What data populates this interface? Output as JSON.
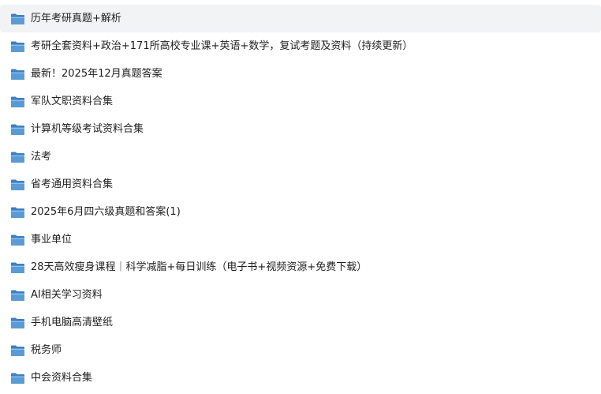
{
  "colors": {
    "folder_body": "#5b9bd5",
    "folder_tab": "#3f7fc1",
    "folder_front": "#8cc0ee",
    "selected_row_bg": "#f2f3f5",
    "text": "#1f1f1f"
  },
  "icons": {
    "folder": "folder-icon"
  },
  "items": [
    {
      "name": "历年考研真题+解析",
      "selected": true
    },
    {
      "name": "考研全套资料+政治+171所高校专业课+英语+数学，复试考题及资料（持续更新）",
      "selected": false
    },
    {
      "name": "最新！2025年12月真题答案",
      "selected": false
    },
    {
      "name": "军队文职资料合集",
      "selected": false
    },
    {
      "name": "计算机等级考试资料合集",
      "selected": false
    },
    {
      "name": "法考",
      "selected": false
    },
    {
      "name": "省考通用资料合集",
      "selected": false
    },
    {
      "name": "2025年6月四六级真题和答案(1)",
      "selected": false
    },
    {
      "name": "事业单位",
      "selected": false
    },
    {
      "name": "28天高效瘦身课程｜科学减脂+每日训练（电子书+视频资源+免费下载）",
      "selected": false
    },
    {
      "name": "AI相关学习资料",
      "selected": false
    },
    {
      "name": "手机电脑高清壁纸",
      "selected": false
    },
    {
      "name": "税务师",
      "selected": false
    },
    {
      "name": "中会资料合集",
      "selected": false
    }
  ]
}
